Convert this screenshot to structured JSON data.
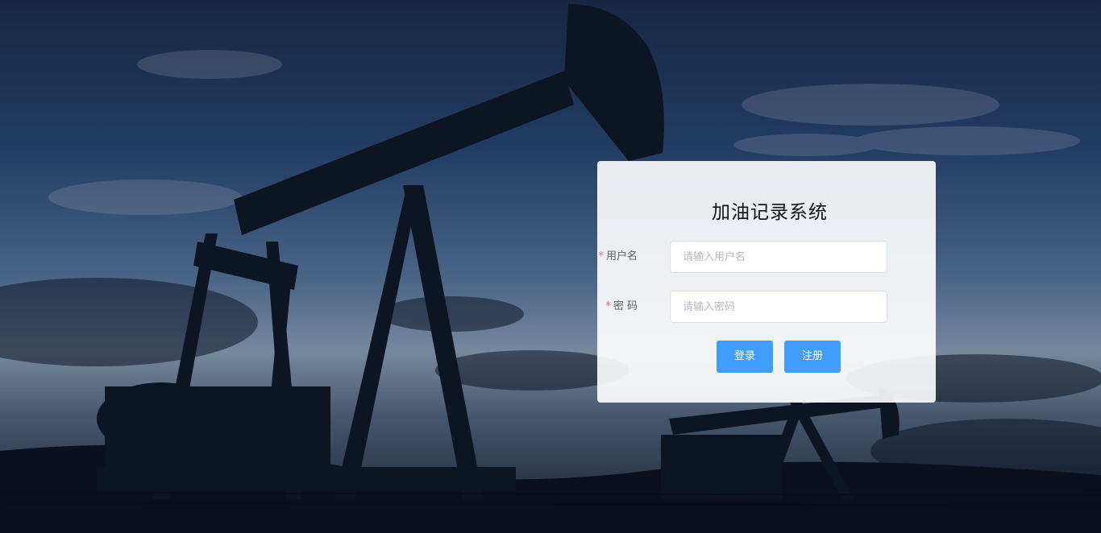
{
  "page": {
    "title": "加油记录系统"
  },
  "form": {
    "username": {
      "required_mark": "*",
      "label": "用户名",
      "placeholder": "请输入用户名",
      "value": ""
    },
    "password": {
      "required_mark": "*",
      "label": "密 码",
      "placeholder": "请输入密码",
      "value": ""
    }
  },
  "actions": {
    "login_label": "登录",
    "register_label": "注册"
  },
  "colors": {
    "primary": "#409eff",
    "required": "#f56c6c"
  },
  "background": {
    "scene": "oil-pumpjack-silhouette-at-dusk"
  }
}
